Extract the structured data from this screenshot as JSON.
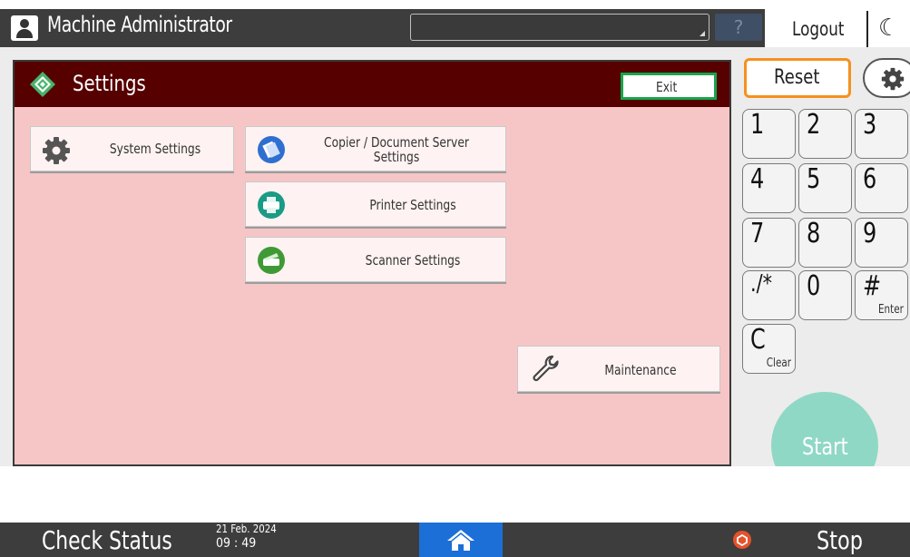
{
  "topbar": {
    "user_name": "Machine Administrator",
    "help_label": "?",
    "logout_label": "Logout"
  },
  "panel": {
    "title": "Settings",
    "exit_label": "Exit",
    "buttons": {
      "system": "System Settings",
      "copier": "Copier / Document Server Settings",
      "printer": "Printer Settings",
      "scanner": "Scanner Settings",
      "maintenance": "Maintenance"
    }
  },
  "keypad": {
    "reset_label": "Reset",
    "keys": [
      {
        "label": "1",
        "sub": ""
      },
      {
        "label": "2",
        "sub": ""
      },
      {
        "label": "3",
        "sub": ""
      },
      {
        "label": "4",
        "sub": ""
      },
      {
        "label": "5",
        "sub": ""
      },
      {
        "label": "6",
        "sub": ""
      },
      {
        "label": "7",
        "sub": ""
      },
      {
        "label": "8",
        "sub": ""
      },
      {
        "label": "9",
        "sub": ""
      },
      {
        "label": "./*",
        "sub": ""
      },
      {
        "label": "0",
        "sub": ""
      },
      {
        "label": "#",
        "sub": "Enter"
      },
      {
        "label": "C",
        "sub": "Clear"
      }
    ],
    "start_label": "Start"
  },
  "bottombar": {
    "check_status_label": "Check Status",
    "date": "21 Feb. 2024",
    "time": "09 : 49",
    "stop_label": "Stop"
  },
  "icons": {
    "user": "user-icon",
    "settings": "settings-diamond-icon",
    "system": "gear-icon",
    "copier": "copier-icon",
    "printer": "printer-icon",
    "scanner": "scanner-icon",
    "maintenance": "wrench-icon",
    "home": "home-icon",
    "stop": "stop-icon",
    "moon": "moon-icon"
  },
  "colors": {
    "panel_header": "#560000",
    "panel_background": "#f6c6c6",
    "reset_border": "#f5911e",
    "exit_border": "#19a54b",
    "start": "#8fd8c6",
    "home": "#1c6fd6"
  }
}
